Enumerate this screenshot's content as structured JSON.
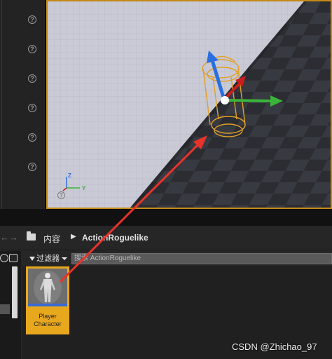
{
  "path_bar": {
    "back_icon": "arrow-left-icon",
    "forward_icon": "arrow-right-icon",
    "folder_icon": "folder-icon",
    "root_label": "内容",
    "separator": "▶",
    "current_label": "ActionRoguelike"
  },
  "toolbar": {
    "filter_label": "过滤器",
    "search_placeholder": "搜索 ActionRoguelike"
  },
  "asset": {
    "name_line1": "Player",
    "name_line2": "Character",
    "thumbnail_icon": "character-mannequin-icon"
  },
  "viewport": {
    "axis_z": "Z",
    "axis_y": "Y",
    "help_glyph": "?"
  },
  "details_panel": {
    "help_glyph": "?"
  },
  "watermark": "CSDN @Zhichao_97",
  "colors": {
    "selection_accent": "#e8a81e",
    "annotation_arrow": "#e8332a",
    "gizmo_x": "#c81e1e",
    "gizmo_y": "#3bb33b",
    "gizmo_z": "#2a6fe0"
  }
}
